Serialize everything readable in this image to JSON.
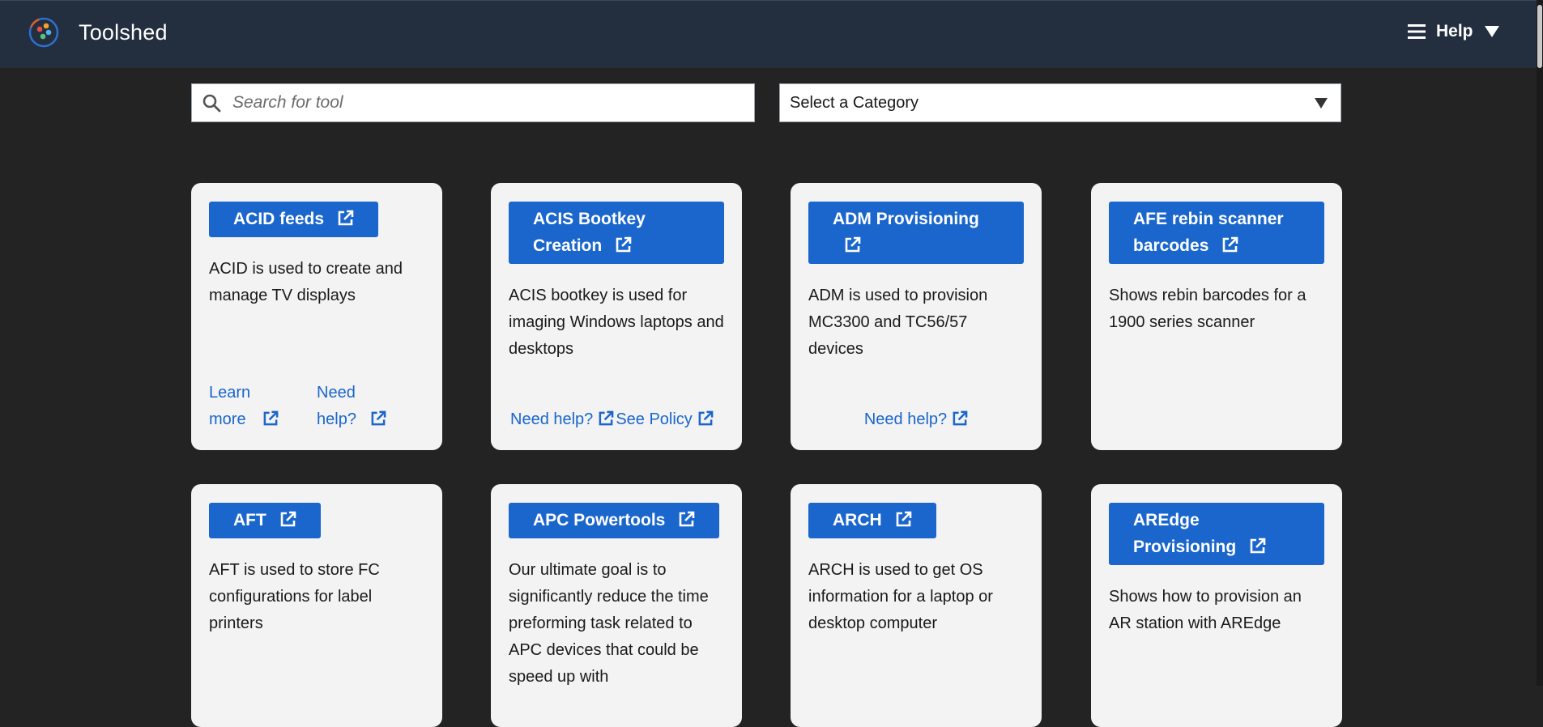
{
  "app": {
    "title": "Toolshed"
  },
  "header": {
    "help_label": "Help"
  },
  "search": {
    "placeholder": "Search for tool",
    "value": ""
  },
  "category_select": {
    "selected": "Select a Category"
  },
  "cards": [
    {
      "title": "ACID feeds",
      "description": "ACID is used to create and manage TV displays",
      "links": [
        "Learn more",
        "Need help?"
      ]
    },
    {
      "title": "ACIS Bootkey Creation",
      "description": "ACIS bootkey is used for imaging Windows laptops and desktops",
      "links": [
        "Need help?",
        "See Policy"
      ]
    },
    {
      "title": "ADM Provisioning",
      "description": "ADM is used to provision MC3300 and TC56/57 devices",
      "links": [
        "Need help?"
      ]
    },
    {
      "title": "AFE rebin scanner barcodes",
      "description": "Shows rebin barcodes for a 1900 series scanner",
      "links": []
    },
    {
      "title": "AFT",
      "description": "AFT is used to store FC configurations for label printers",
      "links": []
    },
    {
      "title": "APC Powertools",
      "description": "Our ultimate goal is to significantly reduce the time preforming task related to APC devices that could be speed up with",
      "links": []
    },
    {
      "title": "ARCH",
      "description": "ARCH is used to get OS information for a laptop or desktop computer",
      "links": []
    },
    {
      "title": "AREdge Provisioning",
      "description": "Shows how to provision an AR station with AREdge",
      "links": []
    }
  ],
  "colors": {
    "header_bg": "#232f3e",
    "page_bg": "#232323",
    "card_bg": "#f3f3f3",
    "accent": "#1a66cc"
  },
  "icons": [
    "toolshed-logo",
    "menu-icon",
    "caret-down-icon",
    "search-icon",
    "external-link-icon"
  ]
}
